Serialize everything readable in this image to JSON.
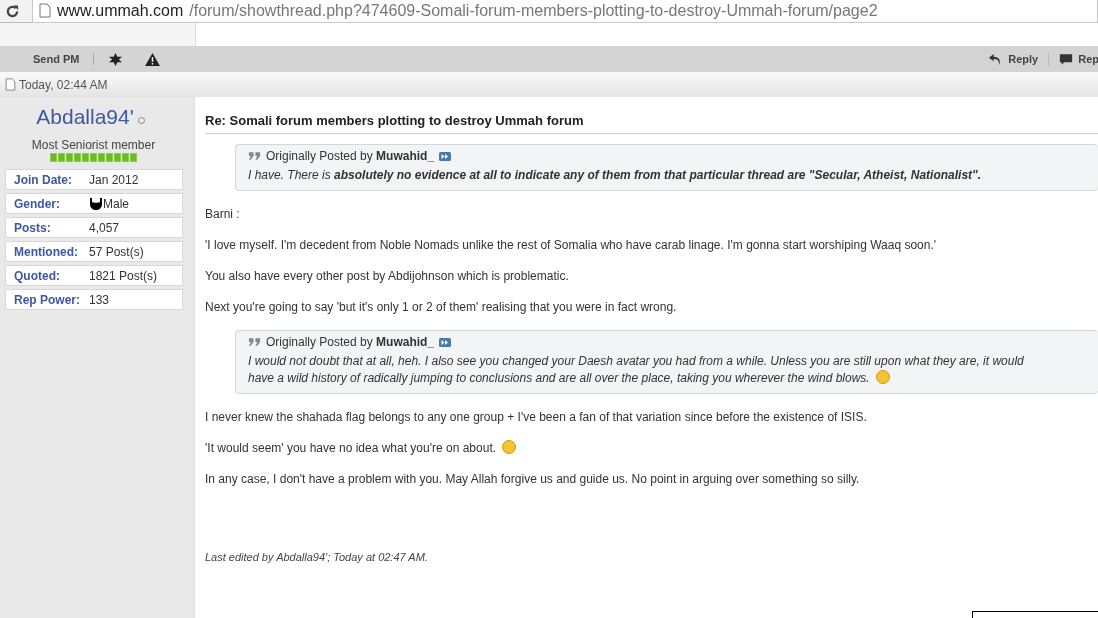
{
  "browser": {
    "url_host": "www.ummah.com",
    "url_path": "/forum/showthread.php?474609-Somali-forum-members-plotting-to-destroy-Ummah-forum/page2"
  },
  "toolbar": {
    "send_pm": "Send PM",
    "reply": "Reply",
    "reply_quote": "Rep"
  },
  "post_date": "Today, 02:44 AM",
  "user": {
    "name": "Abdalla94'",
    "online": false,
    "rank": "Most Seniorist member",
    "info": [
      {
        "label": "Join Date:",
        "value": "Jan 2012"
      },
      {
        "label": "Gender:",
        "value": "Male",
        "kind": "gender"
      },
      {
        "label": "Posts:",
        "value": "4,057"
      },
      {
        "label": "Mentioned:",
        "value": "57 Post(s)"
      },
      {
        "label": "Quoted:",
        "value": "1821 Post(s)"
      },
      {
        "label": "Rep Power:",
        "value": "133"
      }
    ]
  },
  "post": {
    "title": "Re: Somali forum members plotting to destroy Ummah forum",
    "blocks": [
      {
        "kind": "quote",
        "prefix": "Originally Posted by",
        "author": "Muwahid_",
        "lines": [
          "I have. There is **absolutely no evidence at all to indicate any of them from that particular thread are \"Secular, Atheist, Nationalist\".**"
        ],
        "smiley": false
      },
      {
        "kind": "text",
        "text": "Barni :",
        "smiley": false
      },
      {
        "kind": "text",
        "text": "'I love myself. I'm decedent from Noble Nomads unlike the rest of Somalia who have carab linage. I'm gonna start worshiping Waaq soon.'",
        "smiley": false
      },
      {
        "kind": "text",
        "text": "You also have every other post by Abdijohnson which is problematic.",
        "smiley": false
      },
      {
        "kind": "text",
        "text": "Next you're going to say 'but it's only 1 or 2 of them' realising that you were in fact wrong.",
        "smiley": false
      },
      {
        "kind": "quote",
        "prefix": "Originally Posted by",
        "author": "Muwahid_",
        "lines": [
          "I would not doubt that at all, heh. I also see you changed your Daesh avatar you had from a while. Unless you are still upon what they are, it would",
          "have a wild history of radically jumping to conclusions and are all over the place, taking you wherever the wind blows."
        ],
        "smiley": true
      },
      {
        "kind": "text",
        "text": "I never knew the shahada flag belongs to any one group + I've been a fan of that variation since before the existence of ISIS.",
        "smiley": false
      },
      {
        "kind": "text",
        "text": "'It would seem' you have no idea what you're on about.",
        "smiley": true
      },
      {
        "kind": "text",
        "text": "In any case, I don't have a problem with you. May Allah forgive us and guide us. No point in arguing over something so silly.",
        "smiley": false
      }
    ],
    "edited": "Last edited by Abdalla94'; Today at 02:47 AM."
  }
}
